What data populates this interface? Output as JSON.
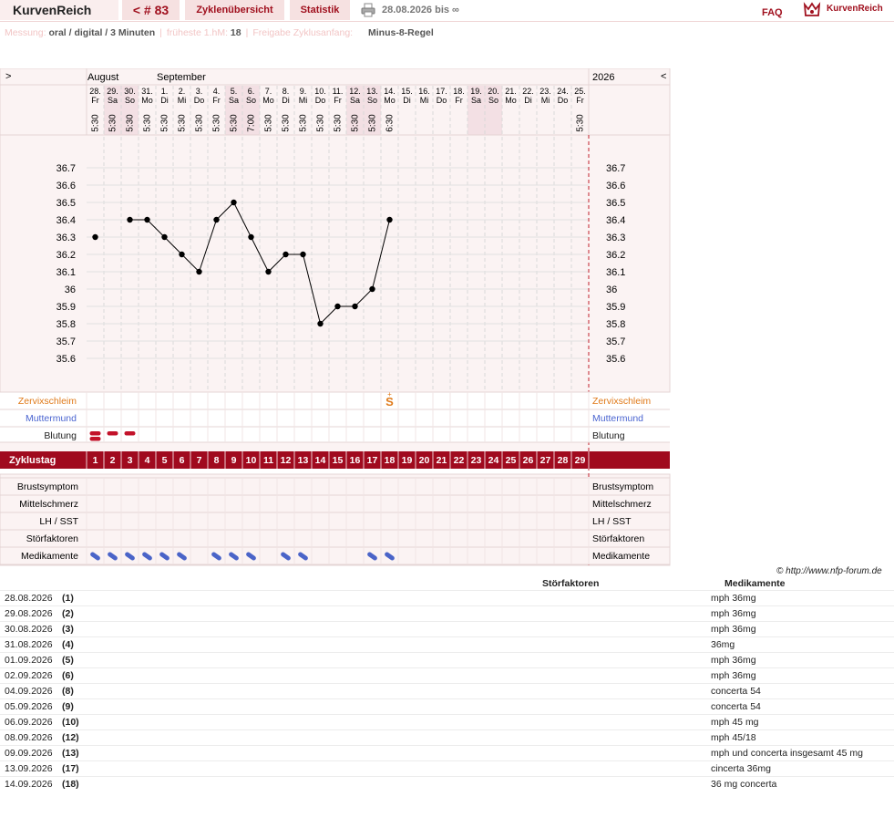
{
  "header": {
    "brand": "KurvenReich",
    "cycle_nav": "< # 83",
    "tab_overview": "Zyklenübersicht",
    "tab_stats": "Statistik",
    "date_range": "28.08.2026 bis ∞",
    "faq": "FAQ",
    "logo_text": "KurvenReich"
  },
  "info": {
    "measure_label": "Messung:",
    "measure_value": "oral / digital / 3 Minuten",
    "earliest_label": "früheste 1.hM:",
    "earliest_value": "18",
    "release_label": "Freigabe Zyklusanfang:",
    "release_value": "Minus-8-Regel"
  },
  "chart_data": {
    "type": "line",
    "nav_left": ">",
    "nav_right": "<",
    "year": "2026",
    "months": [
      {
        "name": "August",
        "col": 0
      },
      {
        "name": "September",
        "col": 4
      }
    ],
    "days": [
      {
        "d": "28.",
        "w": "Fr",
        "t": "5:30"
      },
      {
        "d": "29.",
        "w": "Sa",
        "t": "5:30"
      },
      {
        "d": "30.",
        "w": "So",
        "t": "5:30"
      },
      {
        "d": "31.",
        "w": "Mo",
        "t": "5:30"
      },
      {
        "d": "1.",
        "w": "Di",
        "t": "5:30"
      },
      {
        "d": "2.",
        "w": "Mi",
        "t": "5:30"
      },
      {
        "d": "3.",
        "w": "Do",
        "t": "5:30"
      },
      {
        "d": "4.",
        "w": "Fr",
        "t": "5:30"
      },
      {
        "d": "5.",
        "w": "Sa",
        "t": "5:30"
      },
      {
        "d": "6.",
        "w": "So",
        "t": "7:00"
      },
      {
        "d": "7.",
        "w": "Mo",
        "t": "5:30"
      },
      {
        "d": "8.",
        "w": "Di",
        "t": "5:30"
      },
      {
        "d": "9.",
        "w": "Mi",
        "t": "5:30"
      },
      {
        "d": "10.",
        "w": "Do",
        "t": "5:30"
      },
      {
        "d": "11.",
        "w": "Fr",
        "t": "5:30"
      },
      {
        "d": "12.",
        "w": "Sa",
        "t": "5:30"
      },
      {
        "d": "13.",
        "w": "So",
        "t": "5:30"
      },
      {
        "d": "14.",
        "w": "Mo",
        "t": "6:30"
      },
      {
        "d": "15.",
        "w": "Di",
        "t": ""
      },
      {
        "d": "16.",
        "w": "Mi",
        "t": ""
      },
      {
        "d": "17.",
        "w": "Do",
        "t": ""
      },
      {
        "d": "18.",
        "w": "Fr",
        "t": ""
      },
      {
        "d": "19.",
        "w": "Sa",
        "t": ""
      },
      {
        "d": "20.",
        "w": "So",
        "t": ""
      },
      {
        "d": "21.",
        "w": "Mo",
        "t": ""
      },
      {
        "d": "22.",
        "w": "Di",
        "t": ""
      },
      {
        "d": "23.",
        "w": "Mi",
        "t": ""
      },
      {
        "d": "24.",
        "w": "Do",
        "t": ""
      },
      {
        "d": "25.",
        "w": "Fr",
        "t": "5:30"
      }
    ],
    "y_ticks": [
      "36.7",
      "36.6",
      "36.5",
      "36.4",
      "36.3",
      "36.2",
      "36.1",
      "36",
      "35.9",
      "35.8",
      "35.7",
      "35.6"
    ],
    "ylim": [
      35.6,
      36.7
    ],
    "temperatures": [
      36.3,
      null,
      36.4,
      36.4,
      36.3,
      36.2,
      36.1,
      36.4,
      36.5,
      36.3,
      36.1,
      36.2,
      36.2,
      35.8,
      35.9,
      35.9,
      36.0,
      36.4
    ],
    "cervix_symbol": "S",
    "cervix_day": 18,
    "bleeding_days": [
      1,
      2,
      3
    ],
    "medication_days": [
      1,
      2,
      3,
      4,
      5,
      6,
      8,
      9,
      10,
      12,
      13,
      17,
      18
    ],
    "cycle_days": [
      "1",
      "2",
      "3",
      "4",
      "5",
      "6",
      "7",
      "8",
      "9",
      "10",
      "11",
      "12",
      "13",
      "14",
      "15",
      "16",
      "17",
      "18",
      "19",
      "20",
      "21",
      "22",
      "23",
      "24",
      "25",
      "26",
      "27",
      "28",
      "29"
    ],
    "row_labels": {
      "cervix": "Zervixschleim",
      "os": "Muttermund",
      "bleeding": "Blutung",
      "cycleday": "Zyklustag",
      "breast": "Brustsymptom",
      "midpain": "Mittelschmerz",
      "lh": "LH / SST",
      "disturb": "Störfaktoren",
      "meds": "Medikamente"
    },
    "colors": {
      "accent": "#a00a1e",
      "cervix": "#e07a1a",
      "os": "#4a64d0",
      "pill": "#4a64c8",
      "weekend": "#f3e0e4",
      "grid_bg": "#fbf3f3"
    }
  },
  "footnote": "© http://www.nfp-forum.de",
  "notes_table": {
    "header_disturb": "Störfaktoren",
    "header_meds": "Medikamente",
    "rows": [
      {
        "date": "28.08.2026",
        "num": "(1)",
        "med": "mph 36mg"
      },
      {
        "date": "29.08.2026",
        "num": "(2)",
        "med": "mph 36mg"
      },
      {
        "date": "30.08.2026",
        "num": "(3)",
        "med": "mph 36mg"
      },
      {
        "date": "31.08.2026",
        "num": "(4)",
        "med": "36mg"
      },
      {
        "date": "01.09.2026",
        "num": "(5)",
        "med": "mph 36mg"
      },
      {
        "date": "02.09.2026",
        "num": "(6)",
        "med": "mph 36mg"
      },
      {
        "date": "04.09.2026",
        "num": "(8)",
        "med": "concerta 54"
      },
      {
        "date": "05.09.2026",
        "num": "(9)",
        "med": "concerta 54"
      },
      {
        "date": "06.09.2026",
        "num": "(10)",
        "med": "mph 45 mg"
      },
      {
        "date": "08.09.2026",
        "num": "(12)",
        "med": "mph 45/18"
      },
      {
        "date": "09.09.2026",
        "num": "(13)",
        "med": "mph und concerta  insgesamt 45 mg"
      },
      {
        "date": "13.09.2026",
        "num": "(17)",
        "med": "cincerta 36mg"
      },
      {
        "date": "14.09.2026",
        "num": "(18)",
        "med": "36 mg concerta"
      }
    ]
  }
}
